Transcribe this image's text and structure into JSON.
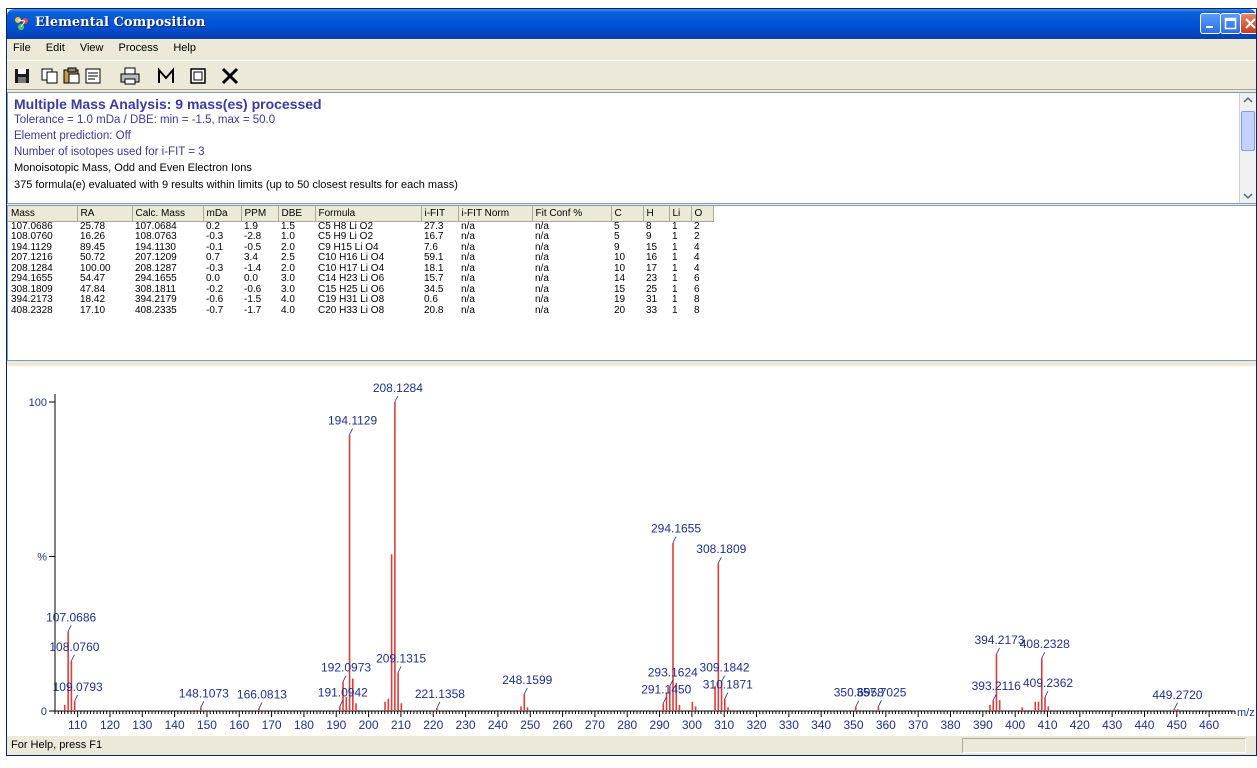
{
  "window": {
    "title": "Elemental Composition"
  },
  "menu": [
    "File",
    "Edit",
    "View",
    "Process",
    "Help"
  ],
  "toolbar_icons": [
    "save-icon",
    "copy-icon",
    "copy-all-icon",
    "paste-icon",
    "print-icon",
    "m-icon",
    "window-icon",
    "close-x-icon"
  ],
  "summary": {
    "title": "Multiple Mass Analysis: 9 mass(es) processed",
    "tolerance": "Tolerance = 1.0 mDa   /   DBE: min = -1.5, max = 50.0",
    "prediction": "Element prediction: Off",
    "isotopes": "Number of isotopes used for i-FIT = 3",
    "ions": "Monoisotopic Mass, Odd and Even Electron Ions",
    "evaluated": "375 formula(e) evaluated with 9 results within limits (up to 50 closest results for each mass)"
  },
  "table": {
    "columns": [
      "Mass",
      "RA",
      "Calc. Mass",
      "mDa",
      "PPM",
      "DBE",
      "Formula",
      "i-FIT",
      "i-FIT Norm",
      "Fit Conf %",
      "C",
      "H",
      "Li",
      "O"
    ],
    "rows": [
      [
        "107.0686",
        "25.78",
        "107.0684",
        "0.2",
        "1.9",
        "1.5",
        "C5 H8 Li O2",
        "27.3",
        "n/a",
        "n/a",
        "5",
        "8",
        "1",
        "2"
      ],
      [
        "108.0760",
        "16.26",
        "108.0763",
        "-0.3",
        "-2.8",
        "1.0",
        "C5 H9 Li O2",
        "16.7",
        "n/a",
        "n/a",
        "5",
        "9",
        "1",
        "2"
      ],
      [
        "194.1129",
        "89.45",
        "194.1130",
        "-0.1",
        "-0.5",
        "2.0",
        "C9 H15 Li O4",
        "7.6",
        "n/a",
        "n/a",
        "9",
        "15",
        "1",
        "4"
      ],
      [
        "207.1216",
        "50.72",
        "207.1209",
        "0.7",
        "3.4",
        "2.5",
        "C10 H16 Li O4",
        "59.1",
        "n/a",
        "n/a",
        "10",
        "16",
        "1",
        "4"
      ],
      [
        "208.1284",
        "100.00",
        "208.1287",
        "-0.3",
        "-1.4",
        "2.0",
        "C10 H17 Li O4",
        "18.1",
        "n/a",
        "n/a",
        "10",
        "17",
        "1",
        "4"
      ],
      [
        "294.1655",
        "54.47",
        "294.1655",
        "0.0",
        "0.0",
        "3.0",
        "C14 H23 Li O6",
        "15.7",
        "n/a",
        "n/a",
        "14",
        "23",
        "1",
        "6"
      ],
      [
        "308.1809",
        "47.84",
        "308.1811",
        "-0.2",
        "-0.6",
        "3.0",
        "C15 H25 Li O6",
        "34.5",
        "n/a",
        "n/a",
        "15",
        "25",
        "1",
        "6"
      ],
      [
        "394.2173",
        "18.42",
        "394.2179",
        "-0.6",
        "-1.5",
        "4.0",
        "C19 H31 Li O8",
        "0.6",
        "n/a",
        "n/a",
        "19",
        "31",
        "1",
        "8"
      ],
      [
        "408.2328",
        "17.10",
        "408.2335",
        "-0.7",
        "-1.7",
        "4.0",
        "C20 H33 Li O8",
        "20.8",
        "n/a",
        "n/a",
        "20",
        "33",
        "1",
        "8"
      ]
    ]
  },
  "chart_data": {
    "type": "bar",
    "xlabel": "m/z",
    "ylabel": "%",
    "xlim": [
      103,
      468
    ],
    "ylim": [
      0,
      100
    ],
    "y_ticks": [
      {
        "value": 0,
        "label": "0"
      },
      {
        "value": 50,
        "label": "%"
      },
      {
        "value": 100,
        "label": "100"
      }
    ],
    "x_ticks": [
      110,
      120,
      130,
      140,
      150,
      160,
      170,
      180,
      190,
      200,
      210,
      220,
      230,
      240,
      250,
      260,
      270,
      280,
      290,
      300,
      310,
      320,
      330,
      340,
      350,
      360,
      370,
      380,
      390,
      400,
      410,
      420,
      430,
      440,
      450,
      460
    ],
    "bar_color": "#e03c3c",
    "label_color": "#1f2f8f",
    "peaks": [
      {
        "x": 106.0,
        "y": 2
      },
      {
        "x": 107.0686,
        "y": 25.78
      },
      {
        "x": 108.076,
        "y": 16.26
      },
      {
        "x": 109.0793,
        "y": 3.2
      },
      {
        "x": 148.1073,
        "y": 1.2
      },
      {
        "x": 166.0813,
        "y": 0.8
      },
      {
        "x": 191.0942,
        "y": 1.5
      },
      {
        "x": 192.0973,
        "y": 9.5
      },
      {
        "x": 193.1,
        "y": 4.5
      },
      {
        "x": 194.1129,
        "y": 89.45
      },
      {
        "x": 195.12,
        "y": 10.5
      },
      {
        "x": 196.12,
        "y": 2.5
      },
      {
        "x": 205.1,
        "y": 3
      },
      {
        "x": 206.1,
        "y": 4
      },
      {
        "x": 207.1216,
        "y": 50.72
      },
      {
        "x": 208.1284,
        "y": 100
      },
      {
        "x": 209.1315,
        "y": 12.5
      },
      {
        "x": 210.13,
        "y": 2.5
      },
      {
        "x": 221.1358,
        "y": 1.0
      },
      {
        "x": 247.15,
        "y": 1.5
      },
      {
        "x": 248.1599,
        "y": 5.5
      },
      {
        "x": 249.16,
        "y": 1.2
      },
      {
        "x": 291.145,
        "y": 2.5
      },
      {
        "x": 292.15,
        "y": 6
      },
      {
        "x": 293.1624,
        "y": 8
      },
      {
        "x": 294.1655,
        "y": 54.47
      },
      {
        "x": 295.17,
        "y": 9
      },
      {
        "x": 296.17,
        "y": 2
      },
      {
        "x": 300.15,
        "y": 3
      },
      {
        "x": 301.15,
        "y": 1.5
      },
      {
        "x": 307.17,
        "y": 8
      },
      {
        "x": 308.1809,
        "y": 47.84
      },
      {
        "x": 309.1842,
        "y": 9.5
      },
      {
        "x": 310.1871,
        "y": 4
      },
      {
        "x": 311.19,
        "y": 1.2
      },
      {
        "x": 350.6958,
        "y": 1.4
      },
      {
        "x": 357.7025,
        "y": 1.5
      },
      {
        "x": 392.2,
        "y": 2
      },
      {
        "x": 393.2116,
        "y": 3.5
      },
      {
        "x": 394.2173,
        "y": 18.42
      },
      {
        "x": 395.22,
        "y": 3.5
      },
      {
        "x": 402.2,
        "y": 1.2
      },
      {
        "x": 406.22,
        "y": 3
      },
      {
        "x": 407.22,
        "y": 3
      },
      {
        "x": 408.2328,
        "y": 17.1
      },
      {
        "x": 409.2362,
        "y": 4.5
      },
      {
        "x": 410.24,
        "y": 1.5
      },
      {
        "x": 449.272,
        "y": 0.7
      },
      {
        "x": 450.27,
        "y": 0.6
      }
    ],
    "annotations": [
      {
        "label": "107.0686",
        "x": 107.0686,
        "y": 25.78
      },
      {
        "label": "108.0760",
        "x": 108.076,
        "y": 16.26
      },
      {
        "label": "109.0793",
        "x": 109.0793,
        "y": 3.2
      },
      {
        "label": "148.1073",
        "x": 148.1073,
        "y": 1.2
      },
      {
        "label": "166.0813",
        "x": 166.0813,
        "y": 0.8
      },
      {
        "label": "191.0942",
        "x": 191.0942,
        "y": 1.5
      },
      {
        "label": "192.0973",
        "x": 192.0973,
        "y": 9.5
      },
      {
        "label": "194.1129",
        "x": 194.1129,
        "y": 89.45
      },
      {
        "label": "208.1284",
        "x": 208.1284,
        "y": 100
      },
      {
        "label": "209.1315",
        "x": 209.1315,
        "y": 12.5
      },
      {
        "label": "221.1358",
        "x": 221.1358,
        "y": 1.0
      },
      {
        "label": "248.1599",
        "x": 248.1599,
        "y": 5.5
      },
      {
        "label": "291.1450",
        "x": 291.145,
        "y": 2.5
      },
      {
        "label": "293.1624",
        "x": 293.1624,
        "y": 8
      },
      {
        "label": "294.1655",
        "x": 294.1655,
        "y": 54.47
      },
      {
        "label": "308.1809",
        "x": 308.1809,
        "y": 47.84
      },
      {
        "label": "309.1842",
        "x": 309.1842,
        "y": 9.5
      },
      {
        "label": "310.1871",
        "x": 310.1871,
        "y": 4
      },
      {
        "label": "350.6958",
        "x": 350.6958,
        "y": 1.4
      },
      {
        "label": "357.7025",
        "x": 357.7025,
        "y": 1.5
      },
      {
        "label": "393.2116",
        "x": 393.2116,
        "y": 3.5
      },
      {
        "label": "394.2173",
        "x": 394.2173,
        "y": 18.42
      },
      {
        "label": "408.2328",
        "x": 408.2328,
        "y": 17.1
      },
      {
        "label": "409.2362",
        "x": 409.2362,
        "y": 4.5
      },
      {
        "label": "449.2720",
        "x": 449.272,
        "y": 0.7
      }
    ]
  },
  "status": {
    "help": "For Help, press F1"
  }
}
